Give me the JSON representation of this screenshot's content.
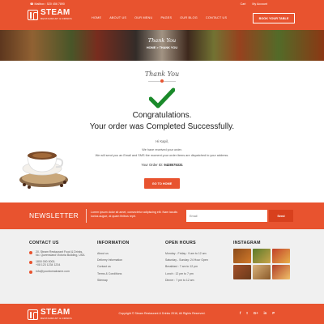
{
  "header": {
    "phone": "☎ Mailbox : 520 456 7890",
    "cart": "Cart",
    "account": "My Account",
    "logo_text": "STEAM",
    "logo_sub": "RESTAURANT & DRINKS",
    "nav": [
      "HOME",
      "ABOUT US",
      "OUR MENU",
      "PAGES",
      "OUR BLOG",
      "CONTACT US"
    ],
    "book_button": "BOOK YOUR TABLE"
  },
  "banner": {
    "title": "Thank You",
    "breadcrumb": "HOME > THANK YOU"
  },
  "main": {
    "script_title": "Thank You",
    "congrats": "Congratulations.",
    "completed": "Your order was Completed Successfully.",
    "greeting": "Hi Kapil,",
    "message_line1": "We have received your order.",
    "message_line2": "We will send you an Email and SMS the moment your order items are dispatched to your address.",
    "order_label": "Your Order ID:",
    "order_id": "9428575331",
    "home_button": "GO TO HOME"
  },
  "newsletter": {
    "title": "NEWSLETTER",
    "description": "Lorem ipsum dolor sit amet, consectetur adipiscing elit. Nam iaculis luctus augue, at quam finibus repit.",
    "email_placeholder": "Email",
    "send_button": "Send"
  },
  "footer": {
    "contact": {
      "heading": "CONTACT US",
      "address_line1": "20, Steam Restaurant Food & Drinks,",
      "address_line2": "No. Queensland Victoria Building, USA",
      "phone_line1": "1800 000 0000,",
      "phone_line2": "+08 123 1234 1234",
      "email": "info@yourdomainame.com"
    },
    "information": {
      "heading": "INFORMATION",
      "links": [
        "About us",
        "Delivery Information",
        "Contact us",
        "Terms & Conditions",
        "Sitemap"
      ]
    },
    "hours": {
      "heading": "OPEN HOURS",
      "rows": [
        "Monday - Friday : 9 am to 12 am",
        "Saturday - Sunday: 24 Hour Open",
        "Breakfast : 7 am to 12 pm",
        "Lunch : 12 pm to 7 pm",
        "Dinner : 7 pm to 12 am"
      ]
    },
    "instagram": {
      "heading": "INSTAGRAM"
    }
  },
  "bottombar": {
    "logo_text": "STEAM",
    "logo_sub": "RESTAURANT & DRINKS",
    "copyright": "Copyright © Steam Restaurant & Drinks 2016, All Rights Reserved.",
    "socials": [
      "f",
      "t",
      "G+",
      "in",
      "P"
    ]
  },
  "colors": {
    "accent": "#e8532f",
    "button_dark": "#d8401d",
    "check_green": "#1a8a2a",
    "footer_bg": "#f0f0f0"
  }
}
